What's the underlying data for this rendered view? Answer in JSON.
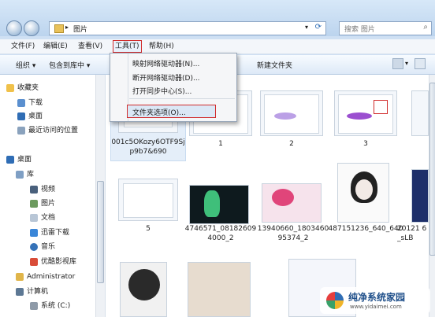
{
  "address": {
    "crumb": "图片"
  },
  "search": {
    "placeholder": "搜索 图片"
  },
  "menubar": [
    "文件(F)",
    "编辑(E)",
    "查看(V)",
    "工具(T)",
    "帮助(H)"
  ],
  "toolbar": {
    "organize": "组织",
    "include": "包含到库中",
    "new_folder": "新建文件夹"
  },
  "tools_menu": [
    "映射网络驱动器(N)...",
    "断开网络驱动器(D)...",
    "打开同步中心(S)...",
    "文件夹选项(O)..."
  ],
  "nav": {
    "favorites": "收藏夹",
    "downloads": "下载",
    "desktop_fav": "桌面",
    "recent": "最近访问的位置",
    "desktop": "桌面",
    "libraries": "库",
    "video": "视频",
    "pictures": "图片",
    "documents": "文档",
    "thunder": "迅雷下载",
    "music": "音乐",
    "youku": "优酷影视库",
    "admin": "Administrator",
    "computer": "计算机",
    "system_c": "系统 (C:)"
  },
  "files": {
    "f0": "001c5OKozy6OTF9Sjp9b7&690",
    "f1": "1",
    "f2": "2",
    "f3": "3",
    "f5": "5",
    "f6": "4746571_081826094000_2",
    "f7": "13940660_180346095374_2",
    "f8": "487151236_640_640",
    "f9": "20121 6_sLB"
  },
  "watermark": {
    "text": "纯净系统家园",
    "url": "www.yidaimei.com"
  },
  "colors": {
    "accent": "#d12b2b",
    "window": "#cfe0f3"
  }
}
